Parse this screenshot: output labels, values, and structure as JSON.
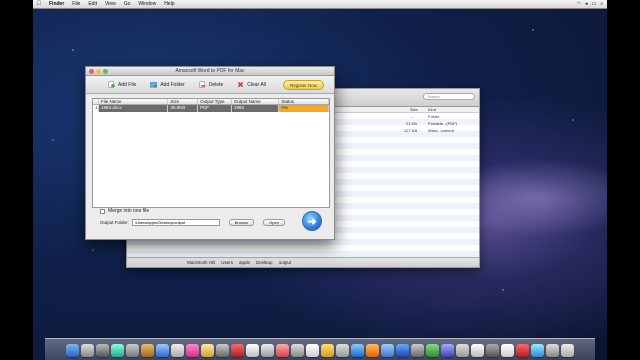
{
  "menubar": {
    "items": [
      "Finder",
      "File",
      "Edit",
      "View",
      "Go",
      "Window",
      "Help"
    ]
  },
  "app": {
    "title": "Amacsoft Word to PDF for Mac",
    "toolbar": {
      "add_file": "Add File",
      "add_folder": "Add Folder",
      "delete": "Delete",
      "clear_all": "Clear All",
      "register": "Register Now"
    },
    "table": {
      "headers": [
        "File Name",
        "Size",
        "Output Type",
        "Output Name",
        "Status"
      ],
      "rows": [
        {
          "index": "1",
          "file_name": "1984.docx",
          "size": "30.9KB",
          "output_type": "PDF",
          "output_name": "1984",
          "status": "0%"
        }
      ]
    },
    "merge_label": "Merge into one file",
    "output_folder_label": "Output Folder:",
    "output_folder_value": "/Users/apple/Desktop/output",
    "browse_label": "Browse",
    "open_label": "Open"
  },
  "finder": {
    "search_placeholder": "Search",
    "columns": [
      "Size",
      "Kind"
    ],
    "rows": [
      {
        "size": "--",
        "kind": "Folder"
      },
      {
        "size": "23 KB",
        "kind": "Portable...(PDF)"
      },
      {
        "size": "127 KB",
        "kind": "Word...cument"
      }
    ],
    "path": [
      "Macintosh HD",
      "Users",
      "apple",
      "Desktop",
      "output"
    ]
  },
  "colors": {
    "status_orange": "#f5a623",
    "selection_gray": "#6b6b6b",
    "go_button_blue": "#2d7fd8"
  }
}
